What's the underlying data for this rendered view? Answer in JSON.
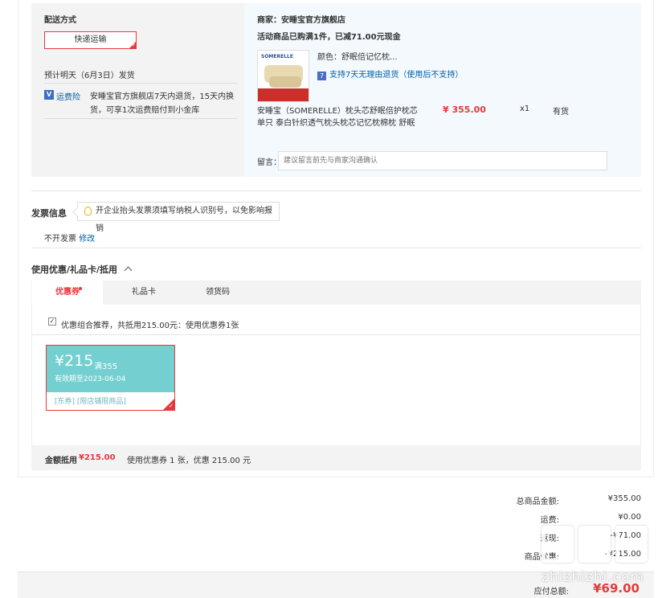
{
  "shipping": {
    "title": "配送方式",
    "method_label": "快递运输",
    "eta": "预计明天（6月3日）发货",
    "insurance_label": "运费险",
    "insurance_text_1": "安睡宝官方旗舰店7天内退货，15天内换",
    "insurance_text_2": "货，可享1次运费赔付到小金库"
  },
  "store": {
    "merchant_label": "商家：",
    "merchant_name": "安睡宝官方旗舰店",
    "promo": "活动商品已购满1件，已减71.00元现金",
    "thumb_logo": "SOMERELLE",
    "color_label": "颜色：",
    "color_value": "舒眠倍记忆枕...",
    "return_icon": "7",
    "return_policy": "支持7天无理由退货（使用后不支持）",
    "product_name_1": "安睡宝（SOMERELLE）枕头芯舒眠倍护枕芯",
    "product_name_2": "单只 泰白针织透气枕头枕芯记忆枕棉枕 舒眠",
    "price": "¥ 355.00",
    "quantity": "x1",
    "stock": "有货",
    "memo_label": "留言：",
    "memo_placeholder": "建议留言前先与商家沟通确认"
  },
  "invoice": {
    "title": "发票信息",
    "tip": "开企业抬头发票须填写纳税人识别号，以免影响报销",
    "status": "不开发票",
    "edit_link": "修改"
  },
  "coupons": {
    "section_title": "使用优惠/礼品卡/抵用",
    "tabs": [
      {
        "label": "优惠券"
      },
      {
        "label": "礼品卡"
      },
      {
        "label": "领货码"
      }
    ],
    "recommend_text": "优惠组合推荐，共抵用215.00元：使用优惠券1张",
    "coupon": {
      "amount": "¥215",
      "condition": "满355",
      "expiry": "有效期至2023-06-04",
      "tags": "[东券] [限店铺限商品]"
    },
    "summary_label": "金额抵用",
    "summary_amount": "¥215.00",
    "summary_detail": "使用优惠券 1 张，优惠 215.00 元"
  },
  "totals": {
    "goods_label": "总商品金额:",
    "goods_value": "¥355.00",
    "freight_label": "运费:",
    "freight_value": "¥0.00",
    "discount_label": "返现:",
    "discount_value": "-¥71.00",
    "coupon_label": "商品优惠:",
    "coupon_value": "-¥215.00",
    "payable_label": "应付总额:",
    "payable_value": "¥69.00"
  },
  "watermark": {
    "text": "zhizhizhi.com"
  },
  "colors": {
    "accent_red": "#e4393c",
    "link_blue": "#005ea7",
    "coupon_teal": "#74cfd0"
  }
}
